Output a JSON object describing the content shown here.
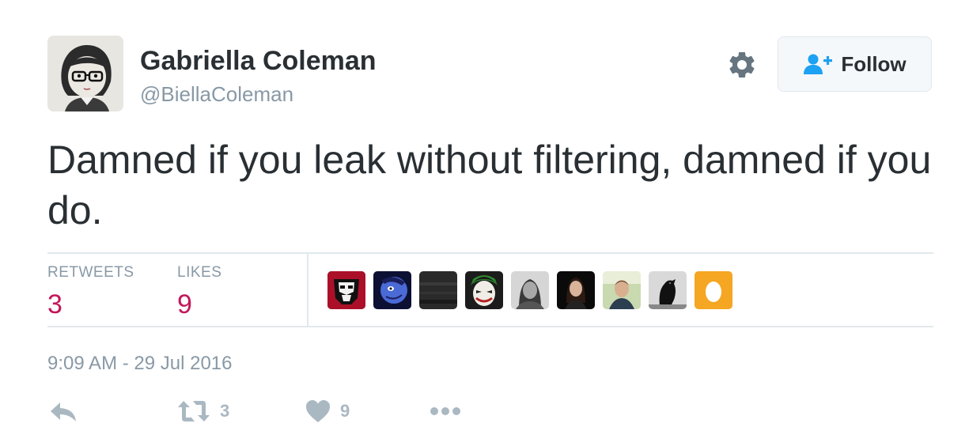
{
  "author": {
    "name": "Gabriella Coleman",
    "handle": "@BiellaColeman"
  },
  "follow_button": {
    "label": "Follow",
    "icon": "follow-person-icon"
  },
  "settings_icon": "gear-icon",
  "tweet": {
    "text": "Damned if you leak without filtering, damned if you do."
  },
  "stats": {
    "retweets_label": "RETWEETS",
    "retweets_count": "3",
    "likes_label": "LIKES",
    "likes_count": "9"
  },
  "likers": [
    {
      "icon": "avatar-stormtrooper"
    },
    {
      "icon": "avatar-blue-cartoon"
    },
    {
      "icon": "avatar-dark"
    },
    {
      "icon": "avatar-joker"
    },
    {
      "icon": "avatar-man-long-hair"
    },
    {
      "icon": "avatar-woman"
    },
    {
      "icon": "avatar-man-outdoors"
    },
    {
      "icon": "avatar-crow"
    },
    {
      "icon": "avatar-default-egg"
    }
  ],
  "timestamp": "9:09 AM - 29 Jul 2016",
  "actions": {
    "reply_icon": "reply-icon",
    "retweet_count": "3",
    "like_count": "9",
    "more_icon": "more-icon"
  },
  "colors": {
    "count_accent": "#c2185b",
    "follow_icon": "#1da1f2",
    "muted_text": "#8899a6"
  }
}
